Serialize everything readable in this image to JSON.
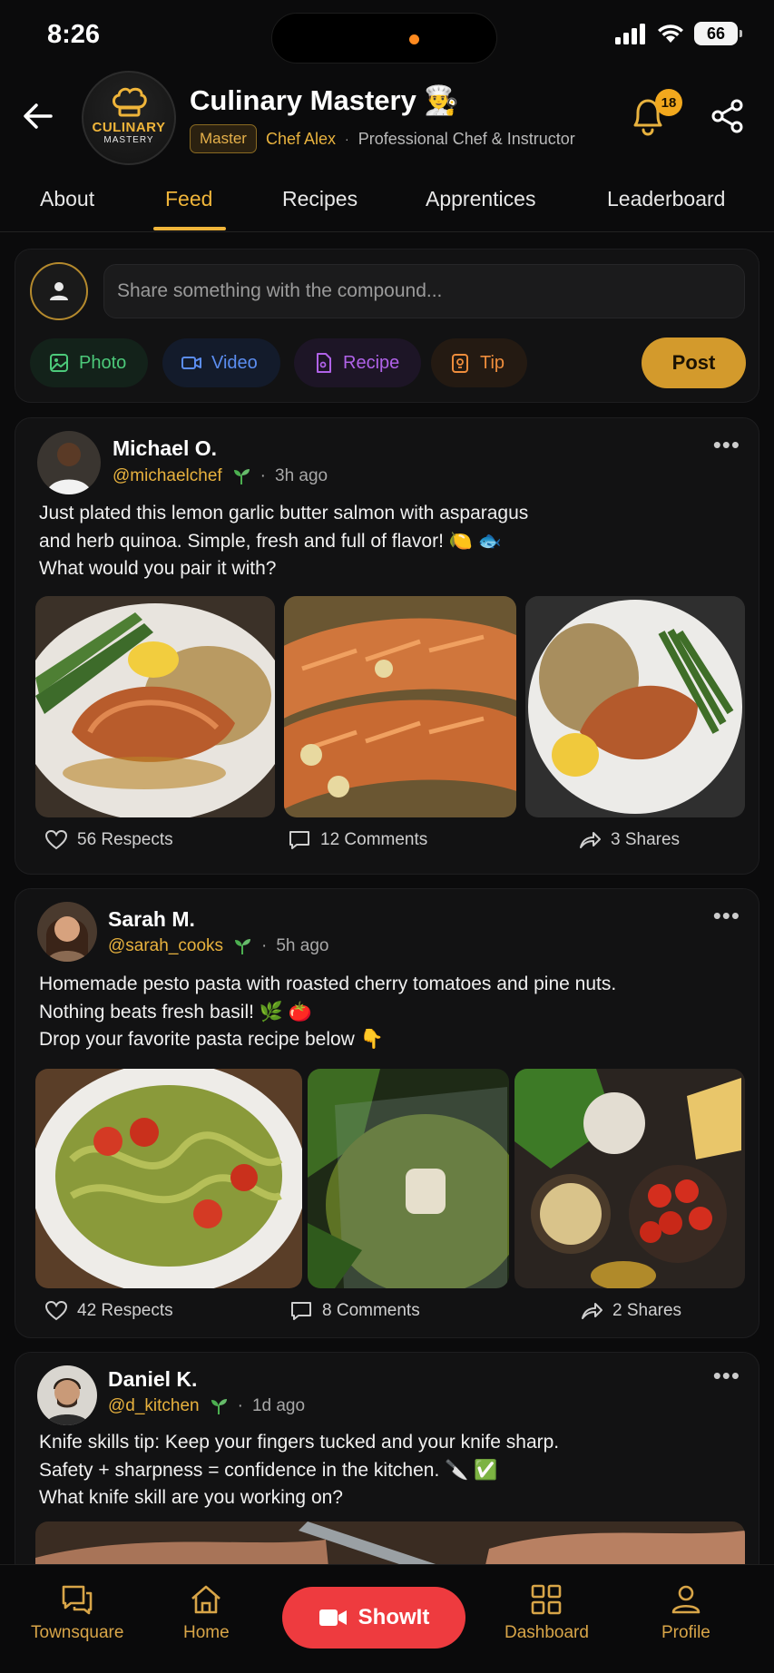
{
  "status_bar": {
    "time": "8:26",
    "battery": "66"
  },
  "header": {
    "title": "Culinary Mastery 👨‍🍳",
    "logo_line1": "CULINARY",
    "logo_line2": "MASTERY",
    "badge": "Master",
    "chef_name": "Chef Alex",
    "dot": "·",
    "chef_role": "Professional Chef & Instructor",
    "notification_count": "18"
  },
  "tabs": [
    {
      "label": "About"
    },
    {
      "label": "Feed",
      "active": true
    },
    {
      "label": "Recipes"
    },
    {
      "label": "Apprentices"
    },
    {
      "label": "Leaderboard"
    }
  ],
  "composer": {
    "placeholder": "Share something with the compound...",
    "chips": {
      "photo": "Photo",
      "video": "Video",
      "recipe": "Recipe",
      "tip": "Tip"
    },
    "post_label": "Post"
  },
  "posts": [
    {
      "name": "Michael O.",
      "handle": "@michaelchef",
      "time": "3h ago",
      "text": [
        "Just plated this lemon garlic butter salmon with asparagus",
        "and herb quinoa. Simple, fresh and full of flavor! 🍋 🐟",
        "What would you pair it with?"
      ],
      "respects": "56 Respects",
      "comments": "12 Comments",
      "shares": "3 Shares"
    },
    {
      "name": "Sarah M.",
      "handle": "@sarah_cooks",
      "time": "5h ago",
      "text": [
        "Homemade pesto pasta with roasted cherry tomatoes and pine nuts.",
        "Nothing beats fresh basil! 🌿 🍅",
        "Drop your favorite pasta recipe below 👇"
      ],
      "respects": "42 Respects",
      "comments": "8 Comments",
      "shares": "2 Shares"
    },
    {
      "name": "Daniel K.",
      "handle": "@d_kitchen",
      "time": "1d ago",
      "text": [
        "Knife skills tip: Keep your fingers tucked and your knife sharp.",
        "Safety + sharpness = confidence in the kitchen. 🔪 ✅",
        "What knife skill are you working on?"
      ]
    }
  ],
  "bottom_nav": {
    "townsquare": "Townsquare",
    "home": "Home",
    "showit": "ShowIt",
    "dashboard": "Dashboard",
    "profile": "Profile"
  },
  "colors": {
    "accent_gold": "#f0b53a",
    "showit_red": "#ee3b3f",
    "background": "#0b0b0c"
  }
}
